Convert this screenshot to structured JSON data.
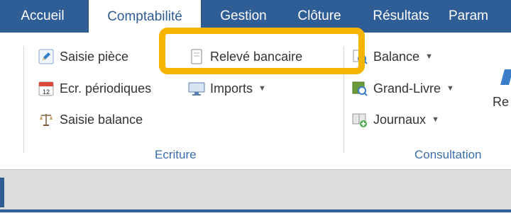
{
  "tabs": [
    {
      "label": "Accueil"
    },
    {
      "label": "Comptabilité"
    },
    {
      "label": "Gestion"
    },
    {
      "label": "Clôture"
    },
    {
      "label": "Résultats"
    },
    {
      "label": "Param"
    }
  ],
  "active_tab": "Comptabilité",
  "ecriture": {
    "saisie_piece": "Saisie pièce",
    "ecr_periodiques": "Ecr. périodiques",
    "saisie_balance": "Saisie balance",
    "releve_bancaire": "Relevé bancaire",
    "imports": "Imports",
    "group_label": "Ecriture"
  },
  "consultation": {
    "balance": "Balance",
    "grand_livre": "Grand-Livre",
    "journaux": "Journaux",
    "group_label": "Consultation",
    "partial_label": "Re"
  },
  "calendar_day": "12",
  "colors": {
    "tabbar": "#2f5d96",
    "highlight": "#f5b400",
    "group_label": "#3b6ea8"
  }
}
